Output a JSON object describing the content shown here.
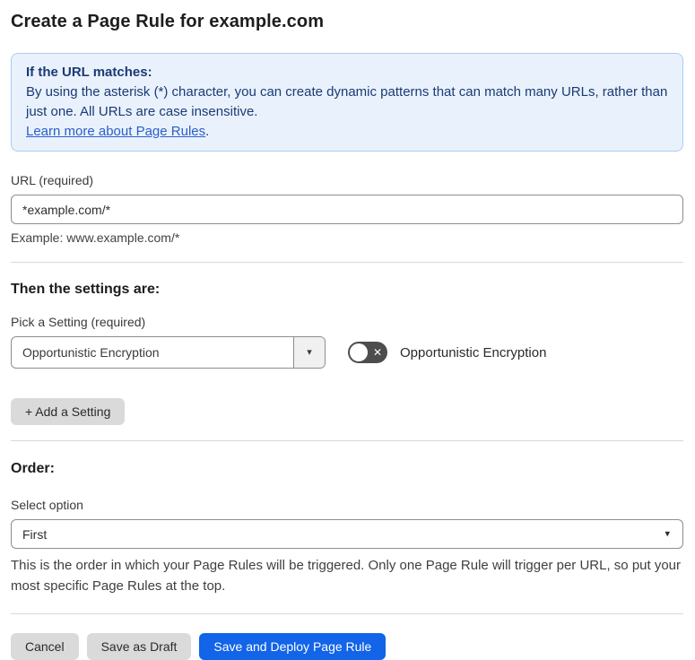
{
  "page": {
    "title": "Create a Page Rule for example.com"
  },
  "info_box": {
    "heading": "If the URL matches:",
    "body": "By using the asterisk (*) character, you can create dynamic patterns that can match many URLs, rather than just one. All URLs are case insensitive.",
    "link_text": "Learn more about Page Rules",
    "link_suffix": "."
  },
  "url_field": {
    "label": "URL (required)",
    "value": "*example.com/*",
    "helper": "Example: www.example.com/*"
  },
  "settings_section": {
    "heading": "Then the settings are:",
    "picker_label": "Pick a Setting (required)",
    "picker_value": "Opportunistic Encryption",
    "picker_caret": "▾",
    "toggle_state": "off",
    "toggle_glyph": "✕",
    "toggle_label": "Opportunistic Encryption",
    "add_button_label": "+ Add a Setting"
  },
  "order_section": {
    "heading": "Order:",
    "select_label": "Select option",
    "select_value": "First",
    "select_caret": "▾",
    "helper": "This is the order in which your Page Rules will be triggered. Only one Page Rule will trigger per URL, so put your most specific Page Rules at the top."
  },
  "footer": {
    "cancel_label": "Cancel",
    "save_draft_label": "Save as Draft",
    "save_deploy_label": "Save and Deploy Page Rule"
  },
  "colors": {
    "primary_blue": "#1264e8",
    "info_bg": "#e9f2fc",
    "info_border": "#aacdf1",
    "info_text": "#1b3a75",
    "link_blue": "#2c5ec9",
    "toggle_off_bg": "#4d4d4d",
    "gray_button_bg": "#dadada",
    "input_border": "#8d8d8d",
    "divider": "#d9d9d9"
  }
}
